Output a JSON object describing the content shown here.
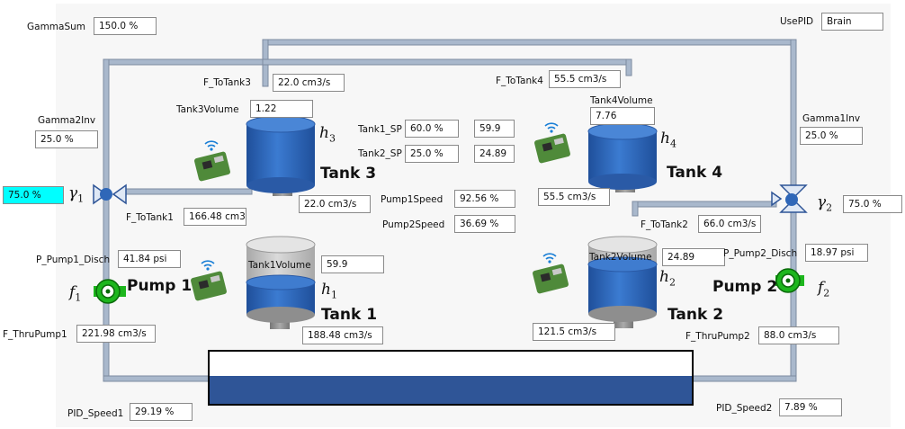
{
  "labels": {
    "gamma_sum": "GammaSum",
    "use_pid": "UsePID",
    "f_to_tank3": "F_ToTank3",
    "f_to_tank4": "F_ToTank4",
    "tank3_volume": "Tank3Volume",
    "tank4_volume": "Tank4Volume",
    "gamma2_inv": "Gamma2Inv",
    "gamma1_inv": "Gamma1Inv",
    "tank1_sp": "Tank1_SP",
    "tank2_sp": "Tank2_SP",
    "pump1_speed": "Pump1Speed",
    "pump2_speed": "Pump2Speed",
    "f_to_tank1": "F_ToTank1",
    "f_to_tank2": "F_ToTank2",
    "p_pump1_disch": "P_Pump1_Disch",
    "p_pump2_disch": "P_Pump2_Disch",
    "tank1_volume": "Tank1Volume",
    "tank2_volume": "Tank2Volume",
    "f_thru_pump1": "F_ThruPump1",
    "f_thru_pump2": "F_ThruPump2",
    "pid_speed1": "PID_Speed1",
    "pid_speed2": "PID_Speed2"
  },
  "values": {
    "gamma_sum": "150.0 %",
    "use_pid": "Brain",
    "f_to_tank3": "22.0 cm3/s",
    "f_to_tank4": "55.5 cm3/s",
    "tank3_volume": "1.22",
    "tank4_volume": "7.76",
    "gamma2_inv": "25.0 %",
    "gamma1_inv": "25.0 %",
    "tank1_sp": "60.0 %",
    "tank1_sp_actual": "59.9",
    "tank2_sp": "25.0 %",
    "tank2_sp_actual": "24.89",
    "pump1_speed": "92.56 %",
    "pump2_speed": "36.69 %",
    "tank3_outflow": "22.0 cm3/s",
    "tank4_outflow": "55.5 cm3/s",
    "gamma1": "75.0 %",
    "gamma2": "75.0 %",
    "f_to_tank1": "166.48 cm3,",
    "f_to_tank2": "66.0 cm3/s",
    "p_pump1_disch": "41.84 psi",
    "p_pump2_disch": "18.97 psi",
    "tank1_volume": "59.9",
    "tank2_volume": "24.89",
    "f_thru_pump1": "221.98 cm3/s",
    "f_thru_pump2": "88.0 cm3/s",
    "tank1_outflow": "188.48 cm3/s",
    "tank2_outflow": "121.5 cm3/s",
    "pid_speed1": "29.19 %",
    "pid_speed2": "7.89 %"
  },
  "tanks": {
    "tank1": "Tank 1",
    "tank2": "Tank 2",
    "tank3": "Tank 3",
    "tank4": "Tank 4"
  },
  "pumps": {
    "pump1": "Pump 1",
    "pump2": "Pump 2"
  },
  "symbols": {
    "h1": "h",
    "h1_sub": "1",
    "h2": "h",
    "h2_sub": "2",
    "h3": "h",
    "h3_sub": "3",
    "h4": "h",
    "h4_sub": "4",
    "gamma1": "γ",
    "gamma1_sub": "1",
    "gamma2": "γ",
    "gamma2_sub": "2",
    "f1": "f",
    "f1_sub": "1",
    "f2": "f",
    "f2_sub": "2"
  },
  "colors": {
    "pipe": "#a9b8cc",
    "pipe_edge": "#7d8ba0",
    "tank_blue": "#2f67b8",
    "tank_gray": "#bfbfbf",
    "pump_green": "#1db61d",
    "highlight": "#00ffff",
    "reservoir": "#2f5597"
  },
  "icons": {
    "board": "raspberry-pi-board-icon",
    "wifi": "wifi-icon"
  }
}
